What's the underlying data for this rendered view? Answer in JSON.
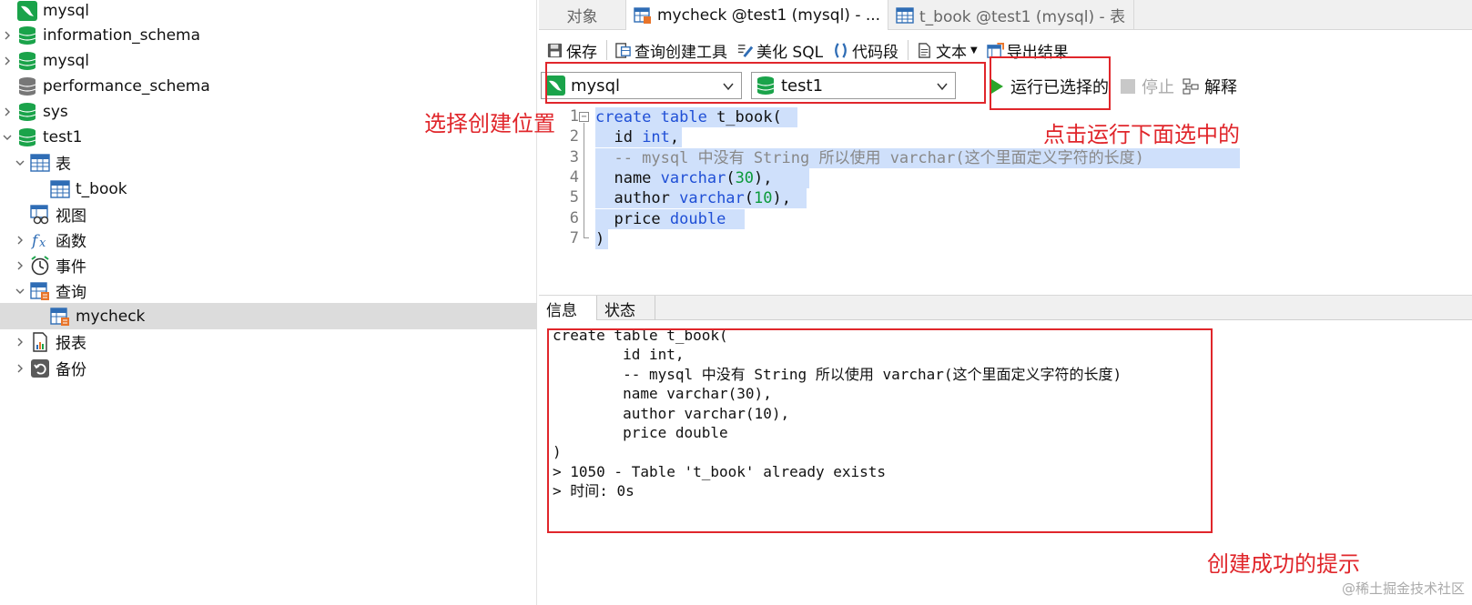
{
  "tree": {
    "items": [
      {
        "label": "mysql",
        "level": 0,
        "icon": "connection-icon",
        "arrow": "none"
      },
      {
        "label": "information_schema",
        "level": 0,
        "icon": "database-icon",
        "arrow": "right"
      },
      {
        "label": "mysql",
        "level": 0,
        "icon": "database-icon",
        "arrow": "right"
      },
      {
        "label": "performance_schema",
        "level": 0,
        "icon": "database-gray-icon",
        "arrow": "none"
      },
      {
        "label": "sys",
        "level": 0,
        "icon": "database-icon",
        "arrow": "right"
      },
      {
        "label": "test1",
        "level": 0,
        "icon": "database-icon",
        "arrow": "down"
      },
      {
        "label": "表",
        "level": 1,
        "icon": "table-icon",
        "arrow": "down"
      },
      {
        "label": "t_book",
        "level": 2,
        "icon": "table-icon",
        "arrow": "none"
      },
      {
        "label": "视图",
        "level": 1,
        "icon": "view-icon",
        "arrow": "none"
      },
      {
        "label": "函数",
        "level": 1,
        "icon": "function-icon",
        "arrow": "right"
      },
      {
        "label": "事件",
        "level": 1,
        "icon": "event-clock-icon",
        "arrow": "right"
      },
      {
        "label": "查询",
        "level": 1,
        "icon": "query-icon",
        "arrow": "down"
      },
      {
        "label": "mycheck",
        "level": 2,
        "icon": "query-icon",
        "arrow": "none",
        "selected": true
      },
      {
        "label": "报表",
        "level": 1,
        "icon": "report-icon",
        "arrow": "right"
      },
      {
        "label": "备份",
        "level": 1,
        "icon": "backup-icon",
        "arrow": "right"
      }
    ]
  },
  "tabs": {
    "objects": "对象",
    "query": "mycheck @test1 (mysql) - ...",
    "table": "t_book @test1 (mysql) - 表"
  },
  "toolbar": {
    "save": "保存",
    "query_builder": "查询创建工具",
    "beautify": "美化 SQL",
    "snippet": "代码段",
    "text": "文本",
    "export": "导出结果"
  },
  "toolbar2": {
    "connection": "mysql",
    "database": "test1",
    "run_selected": "运行已选择的",
    "stop": "停止",
    "explain": "解释"
  },
  "editor": {
    "lines": [
      {
        "n": "1",
        "parts": [
          [
            "kw",
            "create table "
          ],
          [
            "pl",
            "t_book("
          ]
        ]
      },
      {
        "n": "2",
        "parts": [
          [
            "pl",
            "  id "
          ],
          [
            "kw",
            "int"
          ],
          [
            "pl",
            ","
          ]
        ]
      },
      {
        "n": "3",
        "parts": [
          [
            "cm",
            "  -- mysql 中没有 String 所以使用 varchar(这个里面定义字符的长度)"
          ]
        ]
      },
      {
        "n": "4",
        "parts": [
          [
            "pl",
            "  name "
          ],
          [
            "kw",
            "varchar"
          ],
          [
            "pl",
            "("
          ],
          [
            "num",
            "30"
          ],
          [
            "pl",
            "),"
          ]
        ]
      },
      {
        "n": "5",
        "parts": [
          [
            "pl",
            "  author "
          ],
          [
            "kw",
            "varchar"
          ],
          [
            "pl",
            "("
          ],
          [
            "num",
            "10"
          ],
          [
            "pl",
            "),"
          ]
        ]
      },
      {
        "n": "6",
        "parts": [
          [
            "pl",
            "  price "
          ],
          [
            "kw",
            "double"
          ]
        ]
      },
      {
        "n": "7",
        "parts": [
          [
            "pl",
            ")"
          ]
        ]
      }
    ]
  },
  "info": {
    "tab_info": "信息",
    "tab_status": "状态",
    "lines": [
      "create table t_book(",
      "        id int,",
      "        -- mysql 中没有 String 所以使用 varchar(这个里面定义字符的长度)",
      "        name varchar(30),",
      "        author varchar(10),",
      "        price double",
      ")",
      "> 1050 - Table 't_book' already exists",
      "> 时间: 0s"
    ]
  },
  "annotations": {
    "select_location": "选择创建位置",
    "run_selected_hint": "点击运行下面选中的",
    "success_hint": "创建成功的提示"
  },
  "watermark": "@稀土掘金技术社区",
  "colors": {
    "annotation_red": "#e0262b",
    "selection": "#cfe0fb",
    "keyword": "#1f4fd6",
    "number": "#0b9a3a",
    "db_green": "#1aa34a"
  }
}
